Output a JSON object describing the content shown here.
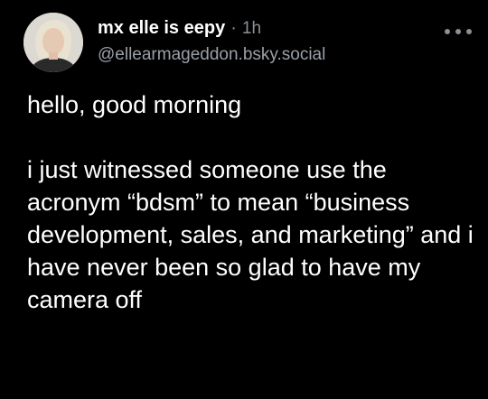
{
  "post": {
    "author": {
      "display_name": "mx elle is eepy",
      "handle": "@ellearmageddon.bsky.social"
    },
    "separator": "·",
    "timestamp": "1h",
    "more_icon": "ellipsis-horizontal-icon",
    "paragraphs": [
      "hello, good morning",
      "i just witnessed someone use the acronym “bdsm” to mean “business development, sales, and marketing” and i have never been so glad to have my camera off"
    ]
  },
  "colors": {
    "background": "#000000",
    "text_primary": "#ffffff",
    "text_secondary": "#9aa0a8"
  }
}
